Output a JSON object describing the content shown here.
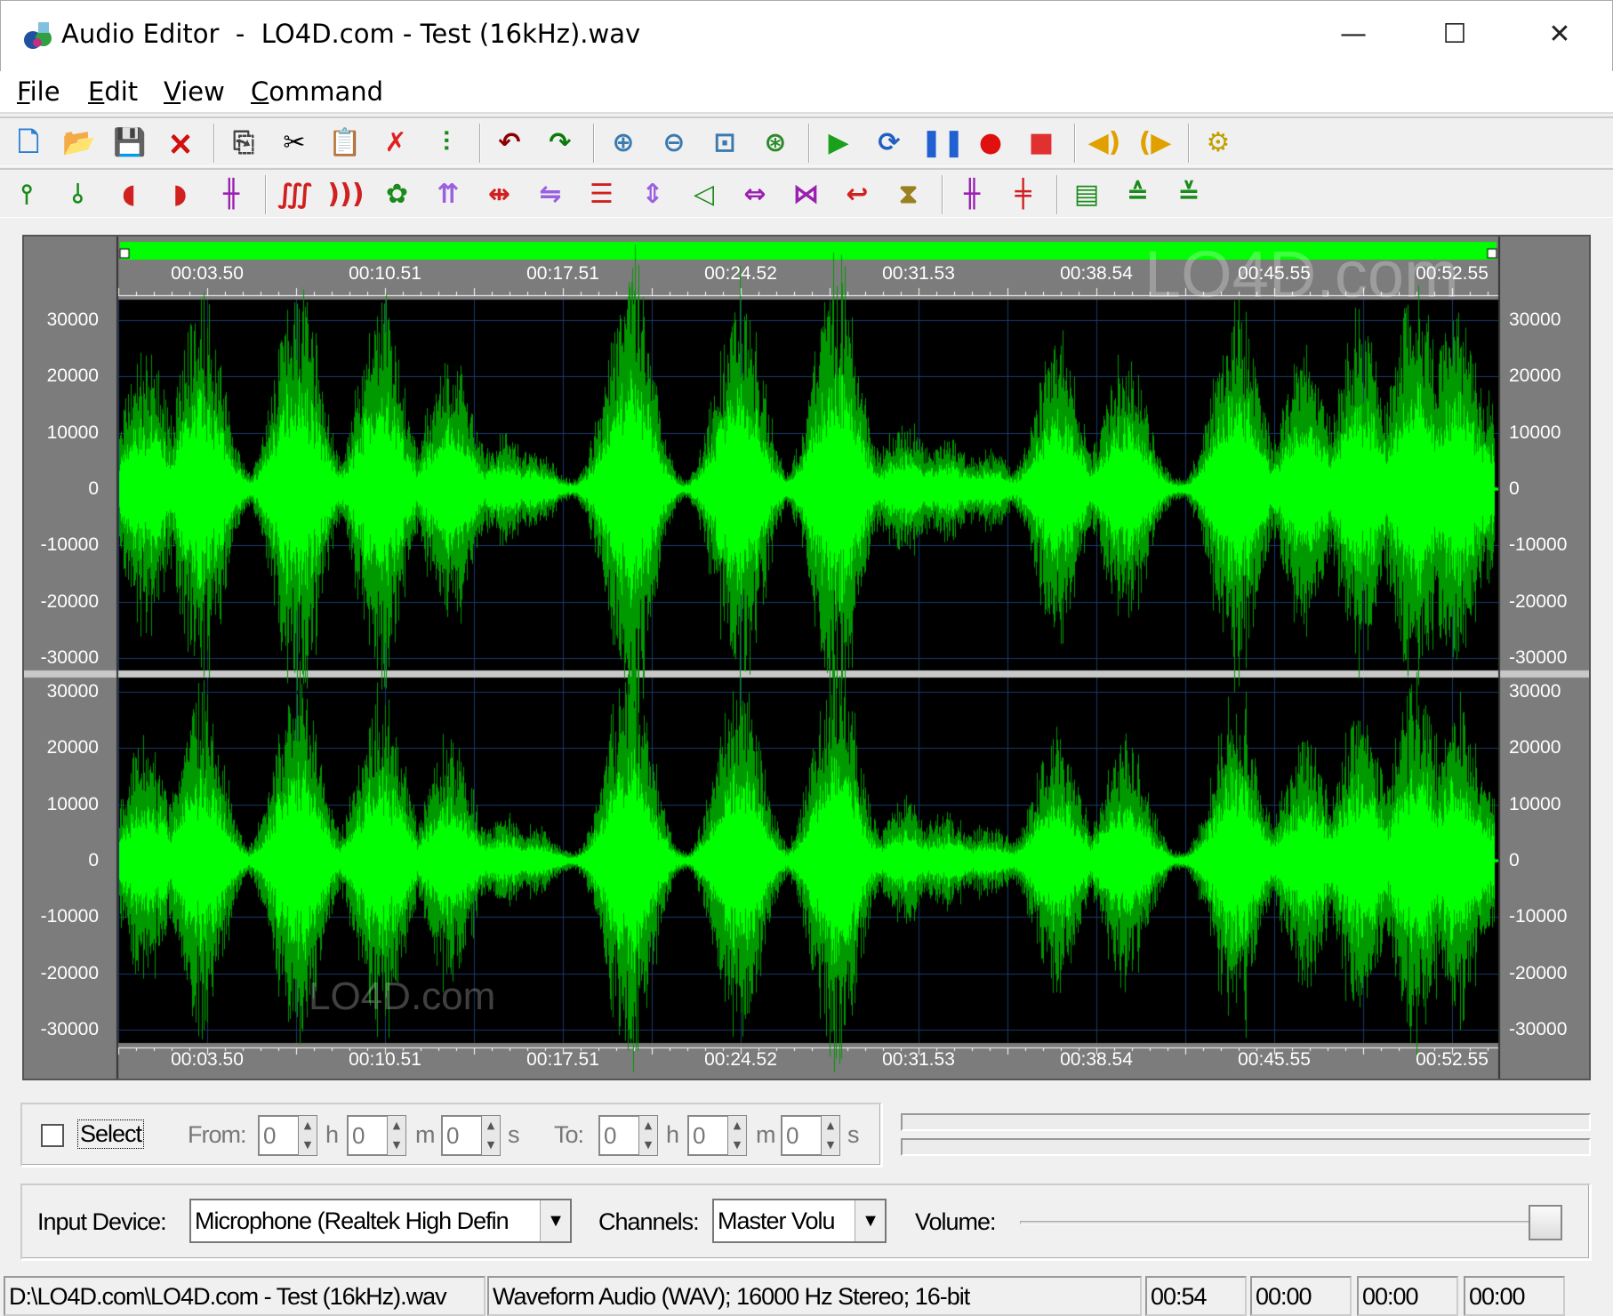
{
  "window": {
    "title": "Audio Editor  -  LO4D.com - Test (16kHz).wav",
    "minimize": "—",
    "maximize": "☐",
    "close": "✕"
  },
  "menu": [
    {
      "label": "File",
      "key": "F",
      "rest": "ile"
    },
    {
      "label": "Edit",
      "key": "E",
      "rest": "dit"
    },
    {
      "label": "View",
      "key": "V",
      "rest": "iew"
    },
    {
      "label": "Command",
      "key": "C",
      "rest": "ommand"
    }
  ],
  "toolbar1": [
    {
      "name": "new-file-icon",
      "glyph": "🗋",
      "color": "#2a7fd4"
    },
    {
      "name": "open-folder-icon",
      "glyph": "📂",
      "color": "#e8a000"
    },
    {
      "name": "save-icon",
      "glyph": "💾",
      "color": "#204080"
    },
    {
      "name": "close-file-icon",
      "glyph": "🗙",
      "color": "#d01010"
    },
    {
      "sep": true
    },
    {
      "name": "copy-icon",
      "glyph": "⎘",
      "color": "#444"
    },
    {
      "name": "cut-icon",
      "glyph": "✂",
      "color": "#000"
    },
    {
      "name": "paste-icon",
      "glyph": "📋",
      "color": "#7a6a30"
    },
    {
      "name": "delete-selection-icon",
      "glyph": "✗",
      "color": "#e02020"
    },
    {
      "name": "mix-paste-icon",
      "glyph": "⫶",
      "color": "#1a8a1a"
    },
    {
      "sep": true
    },
    {
      "name": "undo-icon",
      "glyph": "↶",
      "color": "#8b0000"
    },
    {
      "name": "redo-icon",
      "glyph": "↷",
      "color": "#0a7a0a"
    },
    {
      "sep": true
    },
    {
      "name": "zoom-in-icon",
      "glyph": "⊕",
      "color": "#3a7ab0"
    },
    {
      "name": "zoom-out-icon",
      "glyph": "⊖",
      "color": "#3a7ab0"
    },
    {
      "name": "zoom-selection-icon",
      "glyph": "⊡",
      "color": "#3a7ab0"
    },
    {
      "name": "zoom-all-icon",
      "glyph": "⊛",
      "color": "#2a8a2a"
    },
    {
      "sep": true
    },
    {
      "name": "play-icon",
      "glyph": "▶",
      "color": "#1aa01a"
    },
    {
      "name": "play-loop-icon",
      "glyph": "⟳",
      "color": "#2060c0"
    },
    {
      "name": "pause-icon",
      "glyph": "❚❚",
      "color": "#2060d0"
    },
    {
      "name": "record-icon",
      "glyph": "●",
      "color": "#e01010"
    },
    {
      "name": "stop-icon",
      "glyph": "■",
      "color": "#e03030"
    },
    {
      "sep": true
    },
    {
      "name": "left-channel-icon",
      "glyph": "◀)",
      "color": "#e0a000"
    },
    {
      "name": "right-channel-icon",
      "glyph": "(▶",
      "color": "#e0a000"
    },
    {
      "sep": true
    },
    {
      "name": "options-icon",
      "glyph": "⚙",
      "color": "#c0a000"
    }
  ],
  "toolbar2": [
    {
      "name": "amplify-icon",
      "glyph": "⫯",
      "color": "#1a8a1a"
    },
    {
      "name": "normalize-icon",
      "glyph": "⫰",
      "color": "#1a8a1a"
    },
    {
      "name": "fade-in-icon",
      "glyph": "◖",
      "color": "#d02020"
    },
    {
      "name": "fade-out-icon",
      "glyph": "◗",
      "color": "#d02020"
    },
    {
      "name": "insert-silence-icon",
      "glyph": "╫",
      "color": "#9a20b0"
    },
    {
      "sep": true
    },
    {
      "name": "noise-icon",
      "glyph": "∭",
      "color": "#d02020"
    },
    {
      "name": "echo-icon",
      "glyph": ")))",
      "color": "#d02020"
    },
    {
      "name": "effects-icon",
      "glyph": "✿",
      "color": "#1a8a1a"
    },
    {
      "name": "stretch-icon",
      "glyph": "⇈",
      "color": "#9a60e0"
    },
    {
      "name": "reverse-icon",
      "glyph": "⇹",
      "color": "#d02020"
    },
    {
      "name": "invert-icon",
      "glyph": "⇋",
      "color": "#9a60e0"
    },
    {
      "name": "equalizer-icon",
      "glyph": "☰",
      "color": "#d02020"
    },
    {
      "name": "pitch-icon",
      "glyph": "⇕",
      "color": "#9a60e0"
    },
    {
      "name": "volume-envelope-icon",
      "glyph": "◁",
      "color": "#1a8a1a"
    },
    {
      "name": "balance-icon",
      "glyph": "⇔",
      "color": "#9a20b0"
    },
    {
      "name": "chorus-icon",
      "glyph": "⋈",
      "color": "#9a20b0"
    },
    {
      "name": "swap-channels-icon",
      "glyph": "↩",
      "color": "#d02020"
    },
    {
      "name": "tempo-icon",
      "glyph": "⧗",
      "color": "#9a8020"
    },
    {
      "sep": true
    },
    {
      "name": "split-icon",
      "glyph": "╫",
      "color": "#9a20b0"
    },
    {
      "name": "remove-marker-icon",
      "glyph": "╪",
      "color": "#d02020"
    },
    {
      "sep": true
    },
    {
      "name": "trim-icon",
      "glyph": "▤",
      "color": "#1a8a1a"
    },
    {
      "name": "mute-top-icon",
      "glyph": "≙",
      "color": "#1a8a1a"
    },
    {
      "name": "mute-bottom-icon",
      "glyph": "≚",
      "color": "#1a8a1a"
    }
  ],
  "waveform": {
    "time_ticks": [
      "00:03.50",
      "00:10.51",
      "00:17.51",
      "00:24.52",
      "00:31.53",
      "00:38.54",
      "00:45.55",
      "00:52.55"
    ],
    "amp_ticks": [
      "30000",
      "20000",
      "10000",
      "0",
      "-10000",
      "-20000",
      "-30000"
    ],
    "wave_color": "#00ff00",
    "wave_dark": "#009900",
    "selection_color": "#00ff00",
    "watermark": "LO4D.com"
  },
  "selection": {
    "checkbox_label": "Select",
    "checked": false,
    "from_label": "From:",
    "to_label": "To:",
    "h": "h",
    "m": "m",
    "s": "s",
    "from": {
      "h": "0",
      "m": "0",
      "s": "0"
    },
    "to": {
      "h": "0",
      "m": "0",
      "s": "0"
    }
  },
  "input": {
    "device_label": "Input Device:",
    "device_value": "Microphone (Realtek High Defin",
    "channels_label": "Channels:",
    "channels_value": "Master Volu",
    "volume_label": "Volume:",
    "volume_level": 1.0
  },
  "status": {
    "path": "D:\\LO4D.com\\LO4D.com - Test (16kHz).wav",
    "format": "Waveform Audio (WAV); 16000 Hz Stereo; 16-bit",
    "duration": "00:54",
    "t1": "00:00",
    "t2": "00:00",
    "t3": "00:00"
  }
}
